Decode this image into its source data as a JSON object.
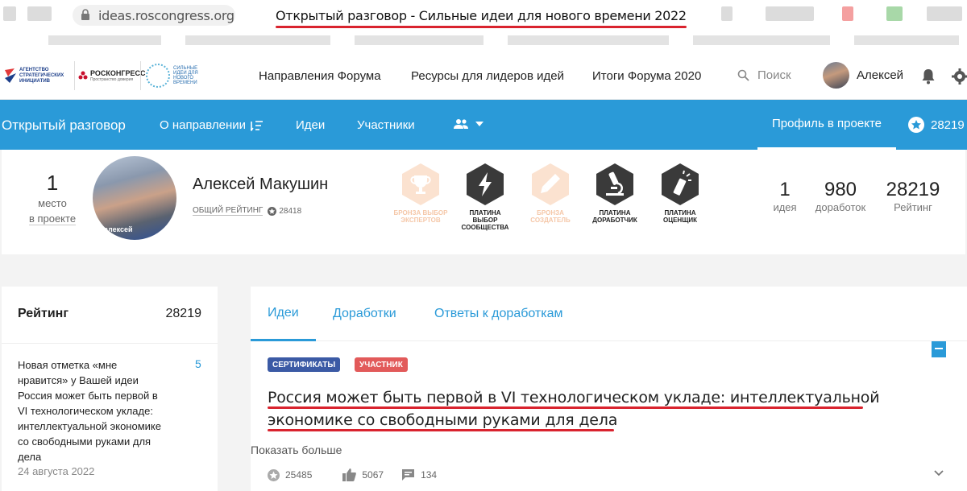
{
  "browser": {
    "url": "ideas.roscongress.org",
    "tab_title": "Открытый разговор - Сильные идеи для нового времени 2022"
  },
  "header": {
    "logos": {
      "asi": "Агентство стратегических инициатив",
      "roscongress": "РОСКОНГРЕСС",
      "roscongress_sub": "Пространство доверия",
      "strong_ideas": "Сильные идеи для нового времени"
    },
    "nav": [
      "Направления Форума",
      "Ресурсы для лидеров идей",
      "Итоги Форума 2020"
    ],
    "search_label": "Поиск",
    "user_name": "Алексей",
    "icons": [
      "search-icon",
      "bell-icon",
      "gear-icon"
    ]
  },
  "project_bar": {
    "title": "Открытый разговор",
    "links": [
      "О направлении",
      "Идеи",
      "Участники"
    ],
    "active_tab": "Профиль в проекте",
    "score": "28219",
    "color": "#2a9ad8"
  },
  "profile": {
    "rank_number": "1",
    "rank_label_1": "место",
    "rank_label_2": "в проекте",
    "avatar_tag": "алексей",
    "name": "Алексей Макушин",
    "rating_label": "Общий рейтинг",
    "rating_value": "28418",
    "badges": [
      {
        "label": "Бронза выбор экспертов",
        "icon": "trophy-icon",
        "state": "faded"
      },
      {
        "label": "Платина выбор сообщества",
        "icon": "lightning-icon",
        "state": "active"
      },
      {
        "label": "Бронза создатель",
        "icon": "pencil-icon",
        "state": "faded"
      },
      {
        "label": "Платина доработчик",
        "icon": "microscope-icon",
        "state": "active"
      },
      {
        "label": "Платина оценщик",
        "icon": "flashlight-icon",
        "state": "active"
      }
    ],
    "stats": [
      {
        "value": "1",
        "label": "идея"
      },
      {
        "value": "980",
        "label": "доработок"
      },
      {
        "value": "28219",
        "label": "Рейтинг"
      }
    ]
  },
  "sidebar": {
    "title": "Рейтинг",
    "value": "28219",
    "notification": {
      "text": "Новая отметка «мне нравится» у Вашей идеи Россия может быть первой в VI технологическом укладе: интеллектуальной экономике со свободными руками для дела",
      "count": "5",
      "date": "24 августа 2022"
    }
  },
  "main": {
    "tabs": [
      "Идеи",
      "Доработки",
      "Ответы к доработкам"
    ],
    "tags": [
      {
        "label": "Сертификаты",
        "color": "#3b5aa5"
      },
      {
        "label": "Участник",
        "color": "#e25a5a"
      }
    ],
    "idea_title": "Россия может быть первой в VI технологическом укладе: интеллектуальной экономике со свободными руками для дела",
    "show_more": "Показать больше",
    "stats": {
      "rating": "25485",
      "likes": "5067",
      "comments": "134"
    }
  }
}
